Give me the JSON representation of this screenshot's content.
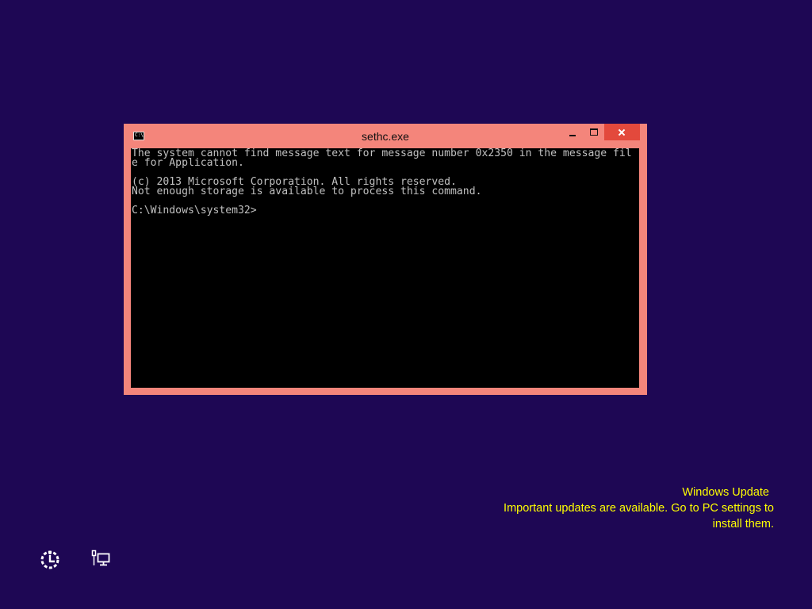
{
  "window": {
    "title": "sethc.exe",
    "icon_label": "C:\\",
    "controls": {
      "minimize": "minimize-icon",
      "maximize": "maximize-icon",
      "close": "close-icon"
    }
  },
  "console": {
    "lines": [
      "The system cannot find message text for message number 0x2350 in the message fil",
      "e for Application.",
      "",
      "(c) 2013 Microsoft Corporation. All rights reserved.",
      "Not enough storage is available to process this command.",
      "",
      "C:\\Windows\\system32>"
    ]
  },
  "notification": {
    "title": "Windows Update",
    "body": "Important updates are available. Go to PC settings to install them."
  },
  "bottom_icons": [
    {
      "name": "ease-of-access-icon"
    },
    {
      "name": "network-icon"
    }
  ],
  "colors": {
    "desktop_background": "#1e0754",
    "window_frame": "#f4857b",
    "close_button": "#e3493c",
    "console_background": "#000000",
    "console_text": "#c0c0c0",
    "notification_text": "#ffff00"
  }
}
